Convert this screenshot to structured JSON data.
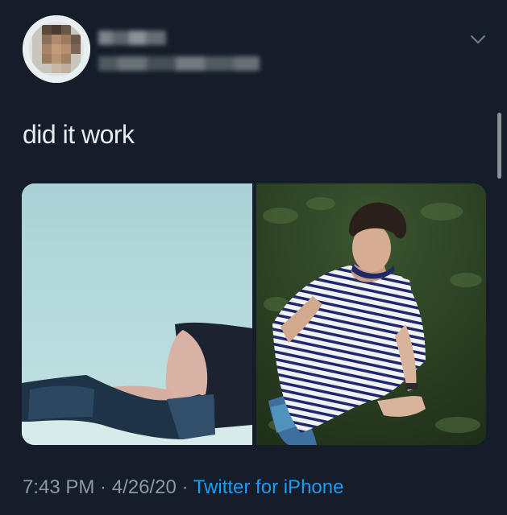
{
  "tweet": {
    "text": "did it work",
    "time": "7:43 PM",
    "separator": " · ",
    "date": "4/26/20",
    "source": "Twitter for iPhone"
  },
  "icons": {
    "menu": "chevron-down-icon",
    "avatar": "profile-avatar"
  },
  "colors": {
    "background": "#141d29",
    "text": "#e7ecf0",
    "muted": "#8b98a5",
    "link": "#1d9bf0"
  }
}
